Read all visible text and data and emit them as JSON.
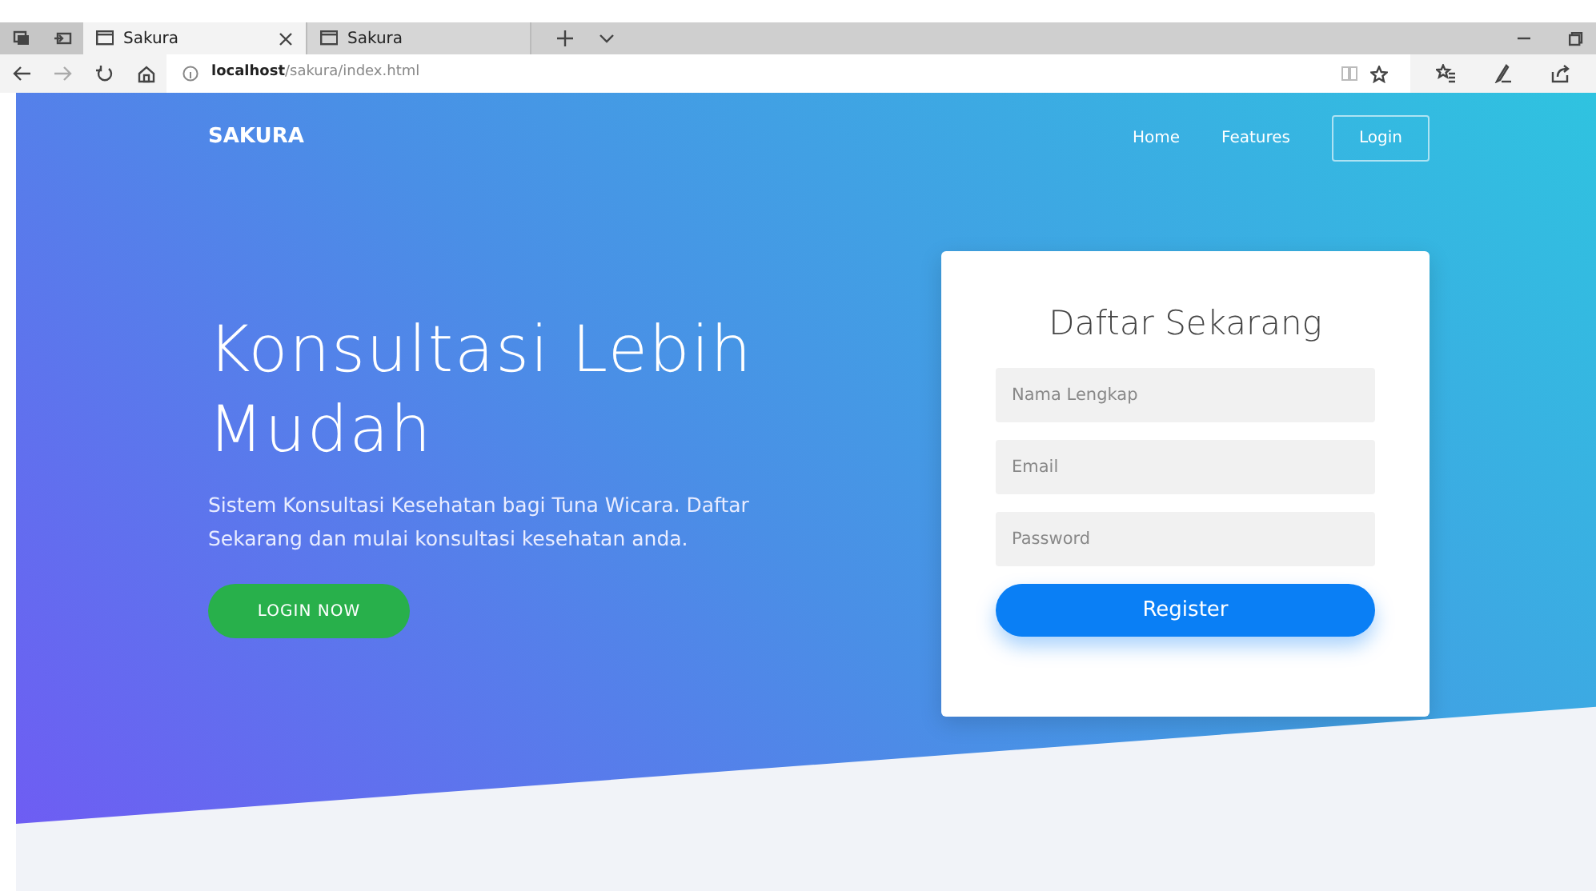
{
  "browser": {
    "tabs": [
      {
        "title": "Sakura",
        "selected": true
      },
      {
        "title": "Sakura",
        "selected": false
      }
    ],
    "address": "**localhost**/sakura/index.html"
  },
  "navbar": {
    "brand": "SAKURA",
    "links": [
      {
        "label": "Home"
      },
      {
        "label": "Features"
      }
    ],
    "login_button": "Login"
  },
  "hero": {
    "title": "Konsultasi Lebih Mudah",
    "subtitle": "Sistem Konsultasi Kesehatan bagi Tuna Wicara. Daftar Sekarang dan mulai konsultasi kesehatan anda.",
    "cta": "LOGIN NOW"
  },
  "form": {
    "title": "Daftar Sekarang",
    "fields": [
      {
        "placeholder": "Nama Lengkap"
      },
      {
        "placeholder": "Email"
      },
      {
        "placeholder": "Password"
      }
    ],
    "submit": "Register"
  }
}
